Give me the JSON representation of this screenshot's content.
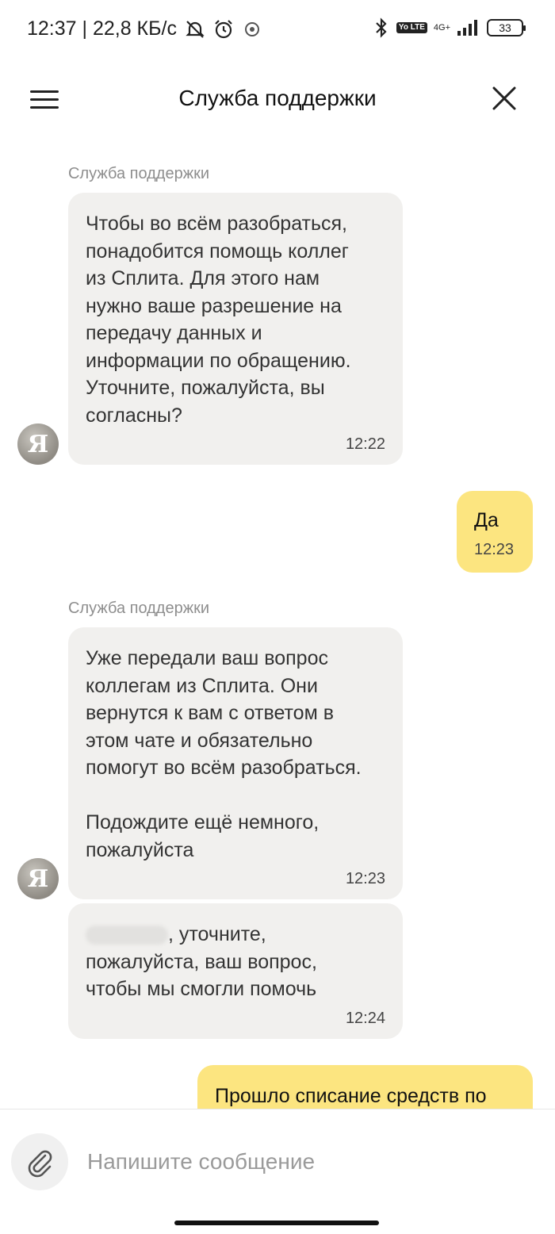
{
  "status_bar": {
    "time_speed": "12:37 | 22,8 КБ/с",
    "volte": "Yo LTE",
    "network": "4G+",
    "battery": "33",
    "icons": [
      "notifications-off-icon",
      "alarm-icon",
      "app-icon",
      "bluetooth-icon",
      "signal-icon",
      "battery-icon"
    ]
  },
  "header": {
    "title": "Служба поддержки",
    "menu_icon": "menu-icon",
    "close_icon": "close-icon"
  },
  "avatar_letter": "Я",
  "messages": [
    {
      "sender": "Служба поддержки",
      "text": "Чтобы во всём разобраться,\nпонадобится помощь коллег\nиз Сплита. Для этого нам\nнужно ваше разрешение на\nпередачу данных и\nинформации по обращению.\nУточните, пожалуйста, вы\nсогласны?",
      "time": "12:22"
    },
    {
      "text": "Да",
      "time": "12:23"
    },
    {
      "sender": "Служба поддержки",
      "text": "Уже передали ваш вопрос\nколлегам из Сплита. Они\nвернутся к вам с ответом в\nэтом чате и обязательно\nпомогут во всём разобраться.\n\nПодождите ещё немного,\nпожалуйста",
      "time": "12:23"
    },
    {
      "text_after_name": ", уточните,\nпожалуйста, ваш вопрос,\nчтобы мы смогли помочь",
      "time": "12:24"
    },
    {
      "text": "Прошло списание средств по"
    }
  ],
  "composer": {
    "placeholder": "Напишите сообщение",
    "attach_icon": "paperclip-icon"
  }
}
